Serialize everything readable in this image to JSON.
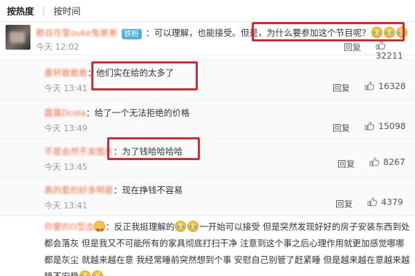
{
  "sort_tabs": {
    "hot": "按热度",
    "separator": "|",
    "time": "按时间"
  },
  "main_comment": {
    "user": "憨自在誓ouke兔崽崽",
    "badge": "铁粉",
    "text_before": "：可以理解，也能接受。但是，",
    "text_highlight": "为什么要参加这个节目呢？",
    "time": "今天 12:02",
    "reply_label": "回复",
    "likes": "32211"
  },
  "replies": [
    {
      "user": "墨轩敢敢敢",
      "text": "：他们实在给的太多了",
      "time": "今天 13:41",
      "reply_label": "回复",
      "likes": "16328"
    },
    {
      "user": "露露Dcola",
      "text": "：给了一个无法拒绝的价格",
      "time": "今天 13:49",
      "reply_label": "回复",
      "likes": "15098"
    },
    {
      "user": "不是会然不发图片",
      "text": "：为了钱哈哈哈哈",
      "time": "今天 13:45",
      "reply_label": "回复",
      "likes": "8267"
    },
    {
      "user": "真的套的好多明星",
      "text": "：现在挣钱不容易",
      "time": "今天 13:41",
      "reply_label": "回复",
      "likes": "4379"
    }
  ],
  "last_reply": {
    "user": "你要的O型血",
    "text_1": "：反正我挺理解的",
    "text_2": "一开始可以接受 但是突然发现好好的房子安装东西到处都会落灰 但是我又不可能所有的家具彻底打扫干净 注意到这个事之后心理作用就更加感觉哪哪都是灰尘 就越来越在意 我经常睡前突然想到个事 安慰自己别管了赶紧睡 但是越来越在意越来越睡不安稳"
  },
  "icons": {
    "like": "thumb-up-icon",
    "emoji": "tears-of-joy-emoji",
    "heart_emoji": "heart-eyes-emoji"
  },
  "colors": {
    "username": "#eb7350",
    "highlight_box": "#d9232d",
    "badge": "#4fb0e3"
  }
}
